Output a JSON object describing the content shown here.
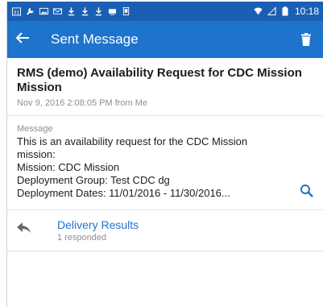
{
  "status_bar": {
    "time": "10:18",
    "left_icons": [
      "calendar-icon",
      "wrench-icon",
      "image-icon",
      "mail-icon",
      "download-icon",
      "download-icon",
      "download-icon",
      "screen-icon",
      "tablet-icon"
    ],
    "calendar_text": "31",
    "right_icons": [
      "wifi-icon",
      "signal-icon",
      "battery-icon"
    ]
  },
  "app_bar": {
    "title": "Sent Message",
    "color": "#1e73cc"
  },
  "subject": {
    "title": "RMS (demo) Availability Request for CDC Mission Mission",
    "meta": "Nov 9, 2016 2:08:05 PM from Me"
  },
  "message": {
    "label": "Message",
    "lines": [
      "This is an availability request for the CDC Mission",
      "mission:",
      "Mission: CDC Mission",
      "Deployment Group: Test CDC dg",
      "Deployment Dates: 11/01/2016 - 11/30/2016..."
    ]
  },
  "delivery": {
    "title": "Delivery Results",
    "subtitle": "1 responded"
  }
}
